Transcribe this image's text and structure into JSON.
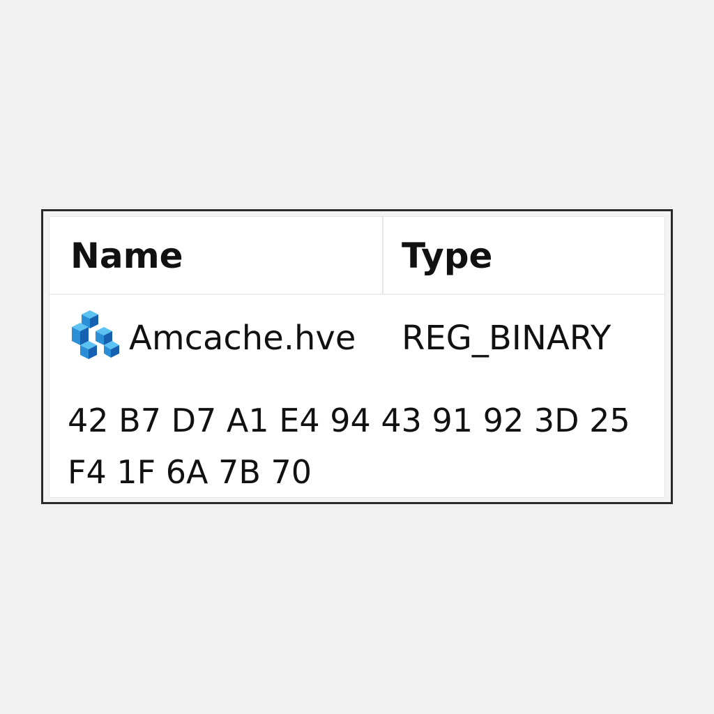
{
  "columns": {
    "name_header": "Name",
    "type_header": "Type"
  },
  "entry": {
    "icon": "registry-cube-icon",
    "name": "Amcache.hve",
    "type": "REG_BINARY",
    "hex_data": "42 B7 D7 A1 E4 94 43 91 92 3D 25 F4 1F 6A 7B 70"
  },
  "colors": {
    "icon_light": "#5cc2f2",
    "icon_mid": "#2b8fd8",
    "icon_dark": "#1560b0"
  }
}
